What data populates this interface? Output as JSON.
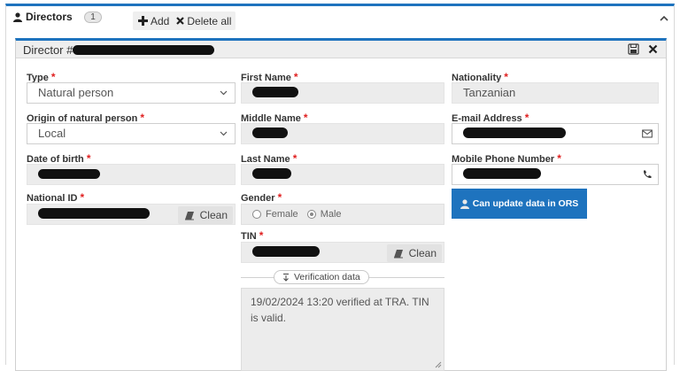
{
  "header": {
    "title": "Directors",
    "count": "1",
    "add_label": "Add",
    "delete_all_label": "Delete all"
  },
  "director": {
    "title_prefix": "Director #"
  },
  "fields": {
    "type": {
      "label": "Type",
      "value": "Natural person"
    },
    "origin": {
      "label": "Origin of natural person",
      "value": "Local"
    },
    "date_of_birth": {
      "label": "Date of birth"
    },
    "national_id": {
      "label": "National ID",
      "clean_label": "Clean"
    },
    "first_name": {
      "label": "First Name"
    },
    "middle_name": {
      "label": "Middle Name"
    },
    "last_name": {
      "label": "Last Name"
    },
    "gender": {
      "label": "Gender",
      "options": [
        "Female",
        "Male"
      ],
      "selected": "Male"
    },
    "tin": {
      "label": "TIN",
      "clean_label": "Clean"
    },
    "nationality": {
      "label": "Nationality",
      "value": "Tanzanian"
    },
    "email": {
      "label": "E-mail Address"
    },
    "mobile": {
      "label": "Mobile Phone Number"
    }
  },
  "verification": {
    "label": "Verification data",
    "text": "19/02/2024 13:20 verified at TRA. TIN is valid."
  },
  "ors_button": {
    "label": "Can update data in ORS"
  },
  "required_marker": "*",
  "colors": {
    "accent": "#1e73be",
    "required": "#e02020",
    "redaction": "#111111"
  },
  "icons": [
    "user-icon",
    "plus-icon",
    "x-icon",
    "chevron-up-icon",
    "save-icon",
    "close-icon",
    "chevron-down-icon",
    "envelope-icon",
    "phone-icon",
    "eraser-icon",
    "arrow-down-icon",
    "user-icon"
  ]
}
